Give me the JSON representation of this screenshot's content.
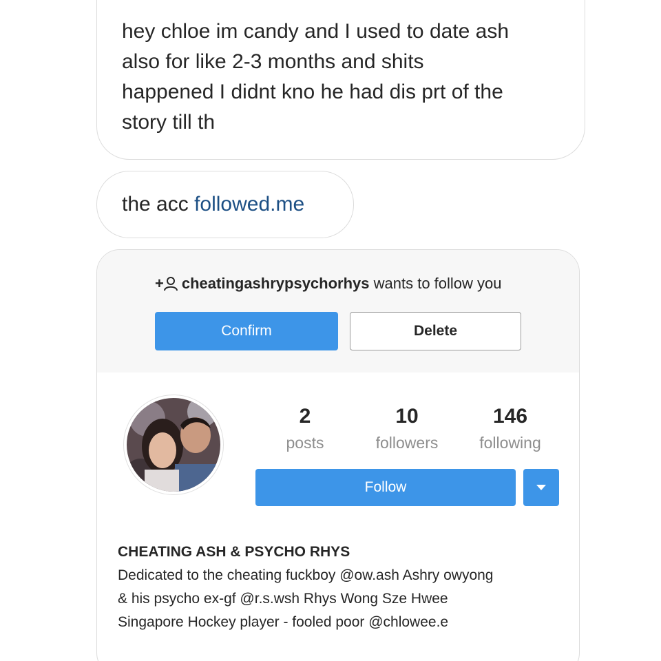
{
  "messages": {
    "msg1": {
      "line1": "hey chloe im candy and I used to date ash",
      "line2": "also for like 2-3 months and shits",
      "line3": "happened I didnt kno he had dis prt of the",
      "line4": "story till th"
    },
    "msg2": {
      "prefix": "the acc ",
      "link": "followed.me"
    }
  },
  "follow_request": {
    "icon": "add-person-icon",
    "plus": "+",
    "username": "cheatingashrypsychorhys",
    "suffix": " wants to follow you",
    "confirm_label": "Confirm",
    "delete_label": "Delete"
  },
  "profile": {
    "stats": {
      "posts": {
        "value": "2",
        "label": "posts"
      },
      "followers": {
        "value": "10",
        "label": "followers"
      },
      "following": {
        "value": "146",
        "label": "following"
      }
    },
    "follow_label": "Follow",
    "dropdown_icon": "caret-down-icon",
    "bio": {
      "name": "CHEATING ASH & PSYCHO RHYS",
      "line1": "Dedicated to the cheating fuckboy @ow.ash Ashry owyong",
      "line2": "& his psycho ex-gf @r.s.wsh Rhys Wong Sze Hwee",
      "line3": "Singapore Hockey player - fooled poor @chlowee.e"
    }
  },
  "colors": {
    "accent_blue": "#3d95e8",
    "link_blue": "#1c4f84",
    "muted_gray": "#8e8e8e",
    "border_gray": "#dcdcdc"
  }
}
